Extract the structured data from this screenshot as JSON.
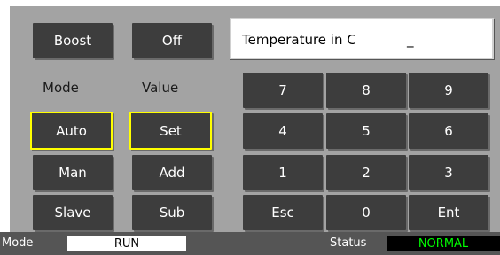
{
  "buttons": {
    "boost": "Boost",
    "off": "Off",
    "auto": "Auto",
    "set": "Set",
    "man": "Man",
    "add": "Add",
    "slave": "Slave",
    "sub": "Sub"
  },
  "labels": {
    "mode": "Mode",
    "value": "Value"
  },
  "display": {
    "text": "Temperature in C",
    "cursor": "_"
  },
  "keypad": {
    "k7": "7",
    "k8": "8",
    "k9": "9",
    "k4": "4",
    "k5": "5",
    "k6": "6",
    "k1": "1",
    "k2": "2",
    "k3": "3",
    "esc": "Esc",
    "k0": "0",
    "ent": "Ent"
  },
  "status_bar": {
    "mode_label": "Mode",
    "mode_value": "RUN",
    "status_label": "Status",
    "status_value": "NORMAL"
  },
  "colors": {
    "panel": "#a3a3a3",
    "button": "#3d3d3d",
    "selected_border": "#ffff00",
    "status_ok_bg": "#000000",
    "status_ok_text": "#00ff00"
  }
}
